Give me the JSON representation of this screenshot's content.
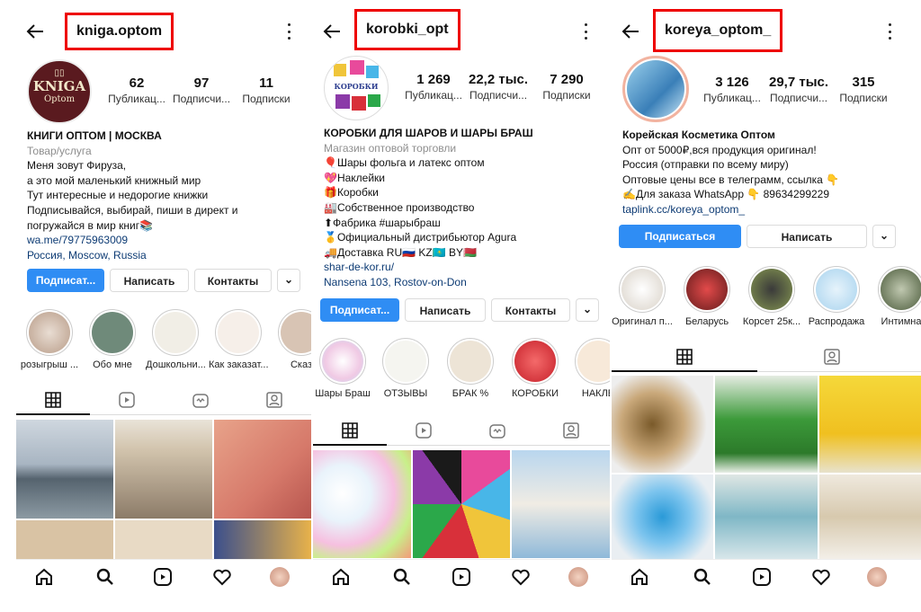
{
  "panels": [
    {
      "username": "kniga.optom",
      "stats": [
        {
          "n": "62",
          "l": "Публикац..."
        },
        {
          "n": "97",
          "l": "Подписчи..."
        },
        {
          "n": "11",
          "l": "Подписки"
        }
      ],
      "avatar_text": {
        "top": "KNIGA",
        "bottom": "Optom"
      },
      "bio": {
        "name": "КНИГИ ОПТОМ | МОСКВА",
        "category": "Товар/услуга",
        "lines": [
          "Меня зовут Фируза,",
          "а это мой маленький книжный мир",
          "Тут интересные и недорогие книжки",
          "Подписывайся, выбирай, пиши в директ и",
          "погружайся в мир книг📚"
        ],
        "links": [
          "wa.me/79775963009",
          "Россия, Moscow, Russia"
        ]
      },
      "buttons": {
        "follow": "Подписат...",
        "message": "Написать",
        "contacts": "Контакты"
      },
      "highlights": [
        "розыгрыш ...",
        "Обо мне",
        "Дошкольни...",
        "Как заказат...",
        "Сказ"
      ]
    },
    {
      "username": "korobki_opt",
      "stats": [
        {
          "n": "1 269",
          "l": "Публикац..."
        },
        {
          "n": "22,2 тыс.",
          "l": "Подписчи..."
        },
        {
          "n": "7 290",
          "l": "Подписки"
        }
      ],
      "avatar_text": {
        "top": "КОРОБКИ",
        "bottom": ""
      },
      "bio": {
        "name": "КОРОБКИ ДЛЯ ШАРОВ И ШАРЫ БРАШ",
        "category": "Магазин оптовой торговли",
        "lines": [
          "🎈Шары фольга и латекс оптом",
          "💖Наклейки",
          "🎁Коробки",
          "🏭Собственное производство",
          "⬆Фабрика #шарыбраш",
          "🥇Официальный дистрибьютор Agura",
          "🚚Доставка RU🇷🇺 KZ🇰🇿 BY🇧🇾"
        ],
        "links": [
          "shar-de-kor.ru/",
          "Nansena 103, Rostov-on-Don"
        ]
      },
      "buttons": {
        "follow": "Подписат...",
        "message": "Написать",
        "contacts": "Контакты"
      },
      "highlights": [
        "Шары Браш",
        "ОТЗЫВЫ",
        "БРАК %",
        "КОРОБКИ",
        "НАКЛЕ"
      ]
    },
    {
      "username": "koreya_optom_",
      "stats": [
        {
          "n": "3 126",
          "l": "Публикац..."
        },
        {
          "n": "29,7 тыс.",
          "l": "Подписчи..."
        },
        {
          "n": "315",
          "l": "Подписки"
        }
      ],
      "bio": {
        "name": "Корейская Косметика Оптом",
        "category": "",
        "lines": [
          "Опт от 5000₽,вся продукция оригинал!",
          "Россия  (отправки по всему миру)",
          "Оптовые цены все в телеграмм, ссылка 👇",
          "✍Для заказа WhatsApp 👇 89634299229"
        ],
        "links": [
          "taplink.cc/koreya_optom_"
        ]
      },
      "buttons": {
        "follow": "Подписаться",
        "message": "Написать"
      },
      "highlights": [
        "Оригинал п...",
        "Беларусь",
        "Корсет 25к...",
        "Распродажа",
        "Интимна"
      ]
    }
  ],
  "icons": {
    "back": "back-arrow-icon",
    "more": "more-vertical-icon",
    "grid": "grid-icon",
    "reels": "reels-icon",
    "igtv": "igtv-icon",
    "tagged": "tagged-icon",
    "home": "home-icon",
    "search": "search-icon",
    "heart": "heart-icon",
    "profile": "profile-avatar-icon"
  },
  "colors": {
    "follow": "#2f8df4",
    "highlight_border": "#e00000",
    "link": "#0d3b74"
  }
}
